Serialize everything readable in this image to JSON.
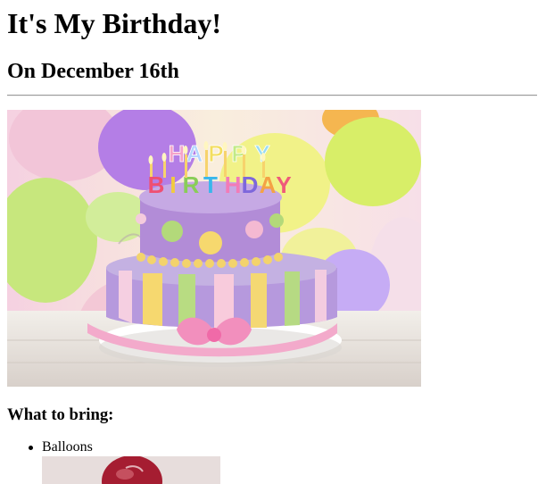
{
  "header": {
    "title": "It's My Birthday!",
    "date": "On December 16th"
  },
  "hero_image": {
    "icon": "birthday-cake-image",
    "cake_lettering": "HAPPY BIRTHDAY"
  },
  "bring_section": {
    "heading": "What to bring:",
    "items": [
      {
        "label": "Balloons",
        "image": "balloon-image"
      }
    ]
  },
  "colors": {
    "cake_purple": "#a98fd8",
    "cake_yellow": "#f6d66a",
    "cake_green": "#b6db7c",
    "cake_pink": "#f3b7cf",
    "balloon_red": "#a11e31"
  }
}
